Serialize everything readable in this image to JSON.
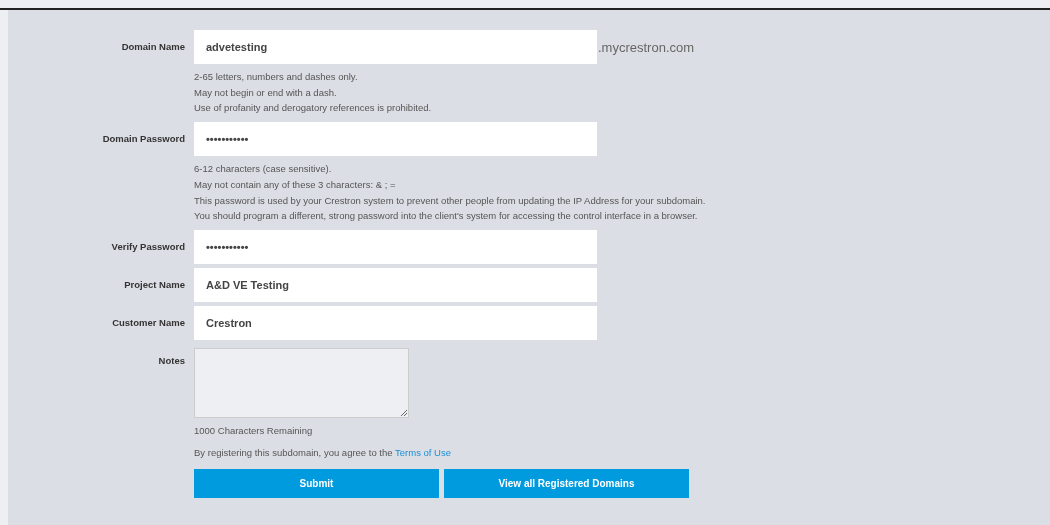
{
  "fields": [
    {
      "label": "Domain Name",
      "kind": "text",
      "value": "advetesting",
      "suffix": ".mycrestron.com",
      "hints": [
        "2-65 letters, numbers and dashes only.",
        "May not begin or end with a dash.",
        "Use of profanity and derogatory references is prohibited."
      ]
    },
    {
      "label": "Domain Password",
      "kind": "text",
      "value": "•••••••••••",
      "hints": [
        "6-12 characters (case sensitive).",
        "May not contain any of these 3 characters: & ; =",
        "This password is used by your Crestron system to prevent other people from updating the IP Address for your subdomain.",
        "You should program a different, strong password into the client's system for accessing the control interface in a browser."
      ]
    },
    {
      "label": "Verify Password",
      "kind": "text",
      "value": "•••••••••••"
    },
    {
      "label": "Project Name",
      "kind": "text",
      "value": "A&D VE Testing"
    },
    {
      "label": "Customer Name",
      "kind": "text",
      "value": "Crestron"
    },
    {
      "label": "Notes",
      "kind": "textarea",
      "hints": [
        "1000 Characters Remaining"
      ]
    }
  ],
  "terms": {
    "text": "By registering this subdomain, you agree to the",
    "link": "Terms of Use"
  },
  "buttons": [
    "Submit",
    "View all Registered Domains"
  ]
}
